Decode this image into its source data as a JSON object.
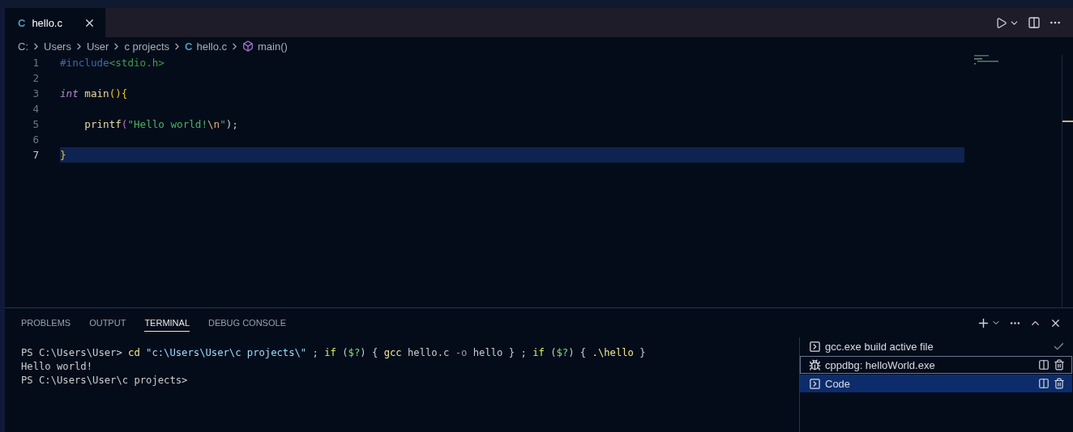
{
  "editor_tabs": [
    {
      "label": "hello.c",
      "file_glyph": "C",
      "selected": true
    }
  ],
  "breadcrumbs": [
    {
      "label": "C:",
      "kind": "folder"
    },
    {
      "label": "Users",
      "kind": "folder"
    },
    {
      "label": "User",
      "kind": "folder"
    },
    {
      "label": "c projects",
      "kind": "folder"
    },
    {
      "label": "hello.c",
      "kind": "file",
      "file_glyph": "C"
    },
    {
      "label": "main()",
      "kind": "symbol"
    }
  ],
  "code_lines": [
    {
      "number": "1",
      "current": false,
      "tokens": [
        {
          "text": "#include",
          "kind": "directive"
        },
        {
          "text": "<stdio.h>",
          "kind": "header"
        }
      ]
    },
    {
      "number": "2",
      "current": false
    },
    {
      "number": "3",
      "current": false,
      "tokens": [
        {
          "text": "int ",
          "kind": "type"
        },
        {
          "text": "main",
          "kind": "function"
        },
        {
          "text": "(){",
          "kind": "bracket"
        }
      ]
    },
    {
      "number": "4",
      "current": false
    },
    {
      "number": "5",
      "current": false,
      "indented": true,
      "tokens": [
        {
          "text": "printf",
          "kind": "function"
        },
        {
          "text": "(",
          "kind": "bracket2"
        },
        {
          "text": "\"Hello world!",
          "kind": "string"
        },
        {
          "text": "\\n",
          "kind": "escape"
        },
        {
          "text": "\"",
          "kind": "string"
        },
        {
          "text": ");",
          "kind": "punct"
        }
      ]
    },
    {
      "number": "6",
      "current": false
    },
    {
      "number": "7",
      "current": true,
      "tokens": [
        {
          "text": "}",
          "kind": "bracket"
        }
      ]
    }
  ],
  "panel_tabs": [
    {
      "label": "PROBLEMS",
      "selected": false
    },
    {
      "label": "OUTPUT",
      "selected": false
    },
    {
      "label": "TERMINAL",
      "selected": true
    },
    {
      "label": "DEBUG CONSOLE",
      "selected": false
    }
  ],
  "terminal_lines": [
    [
      {
        "text": "PS C:\\Users\\User> ",
        "kind": "plain"
      },
      {
        "text": "cd ",
        "kind": "command"
      },
      {
        "text": "\"c:\\Users\\User\\c projects\\\"",
        "kind": "string"
      },
      {
        "text": " ; ",
        "kind": "plain"
      },
      {
        "text": "if",
        "kind": "keyword"
      },
      {
        "text": " (",
        "kind": "plain"
      },
      {
        "text": "$?",
        "kind": "variable"
      },
      {
        "text": ") { ",
        "kind": "plain"
      },
      {
        "text": "gcc",
        "kind": "command"
      },
      {
        "text": " hello.c ",
        "kind": "plain"
      },
      {
        "text": "-o",
        "kind": "parameter"
      },
      {
        "text": " hello } ; ",
        "kind": "plain"
      },
      {
        "text": "if",
        "kind": "keyword"
      },
      {
        "text": " (",
        "kind": "plain"
      },
      {
        "text": "$?",
        "kind": "variable"
      },
      {
        "text": ") { ",
        "kind": "plain"
      },
      {
        "text": ".\\hello",
        "kind": "command"
      },
      {
        "text": " }",
        "kind": "plain"
      }
    ],
    [
      {
        "text": "Hello world!",
        "kind": "plain"
      }
    ],
    [
      {
        "text": "PS C:\\Users\\User\\c projects>",
        "kind": "plain"
      }
    ]
  ],
  "terminals": [
    {
      "label": "gcc.exe build active file",
      "kind": "task",
      "selected": false,
      "focused": false
    },
    {
      "label": "cppdbg: helloWorld.exe",
      "kind": "debug",
      "selected": false,
      "focused": true
    },
    {
      "label": "Code",
      "kind": "shell",
      "selected": true,
      "focused": false
    }
  ]
}
